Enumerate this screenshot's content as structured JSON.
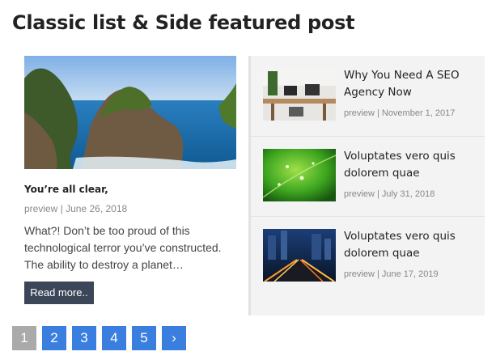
{
  "section": {
    "title": "Classic list & Side featured post"
  },
  "featured": {
    "image_alt": "Rocky islands in a blue sea",
    "title": "You’re all clear,",
    "meta": "preview | June 26, 2018",
    "excerpt": "What?! Don’t be too proud of this technological terror you’ve constructed. The ability to destroy a planet…",
    "read_more_label": "Read more.."
  },
  "side_posts": [
    {
      "title": "Why You Need A SEO Agency Now",
      "meta": "preview | November 1, 2017",
      "thumb": "office-thumbnail"
    },
    {
      "title": "Voluptates vero quis dolorem quae",
      "meta": "preview | July 31, 2018",
      "thumb": "green-leaf-thumbnail"
    },
    {
      "title": "Voluptates vero quis dolorem quae",
      "meta": "preview | June 17, 2019",
      "thumb": "city-night-thumbnail"
    }
  ],
  "pagination": {
    "pages": [
      "1",
      "2",
      "3",
      "4",
      "5"
    ],
    "current": "1",
    "next_label": "›",
    "colors": {
      "active": "#3a7fdf",
      "current": "#aaaaaa"
    }
  }
}
